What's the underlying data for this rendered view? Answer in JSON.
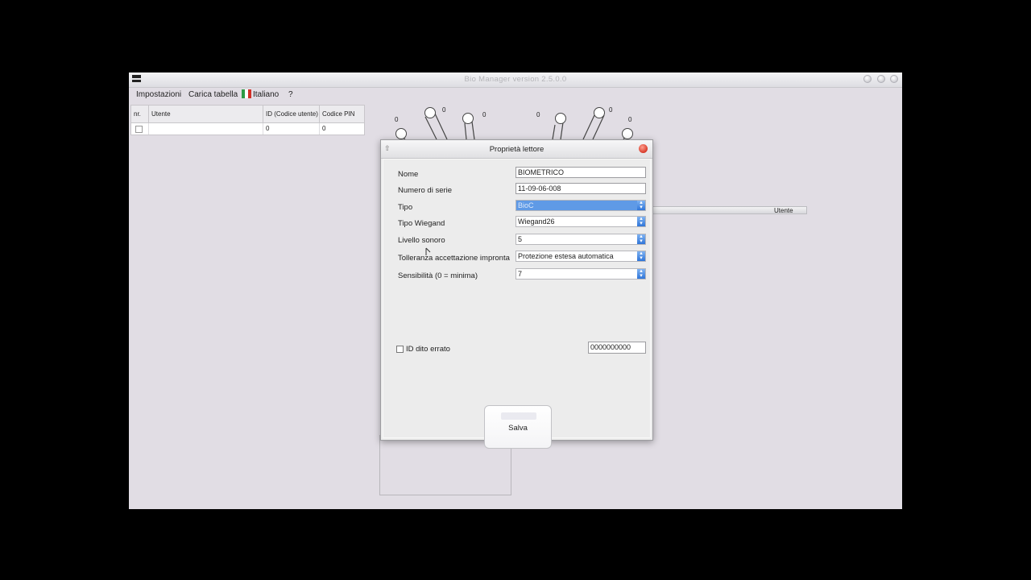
{
  "window": {
    "title": "Bio Manager version 2.5.0.0"
  },
  "menu": {
    "items": [
      "Impostazioni",
      "Carica tabella",
      "Italiano",
      "?"
    ]
  },
  "grid": {
    "headers": [
      "nr.",
      "Utente",
      "ID (Codice utente)",
      "Codice PIN"
    ],
    "row": {
      "nr": "",
      "utente": "",
      "id": "0",
      "pin": "0"
    }
  },
  "fingers": {
    "left_labels": [
      "0",
      "0",
      "0"
    ],
    "right_labels": [
      "0",
      "0",
      "0"
    ]
  },
  "strip": {
    "label": "Utente"
  },
  "dialog": {
    "title": "Proprietà lettore",
    "fields": {
      "nome": {
        "label": "Nome",
        "value": "BIOMETRICO"
      },
      "serie": {
        "label": "Numero di serie",
        "value": "11-09-06-008"
      },
      "tipo": {
        "label": "Tipo",
        "value": "BioC"
      },
      "wiegand": {
        "label": "Tipo Wiegand",
        "value": "Wiegand26"
      },
      "livello": {
        "label": "Livello sonoro",
        "value": "5"
      },
      "tolleranza": {
        "label": "Tolleranza accettazione impronta",
        "value": "Protezione estesa automatica"
      },
      "sensibilita": {
        "label": "Sensibilità (0 = minima)",
        "value": "7"
      }
    },
    "check": {
      "label": "ID dito errato",
      "checked": false
    },
    "id_value": "0000000000",
    "save_label": "Salva"
  },
  "colors": {
    "window_bg": "#e1dde4",
    "selection": "#5f9ae6",
    "close_red": "#d83a2a"
  }
}
